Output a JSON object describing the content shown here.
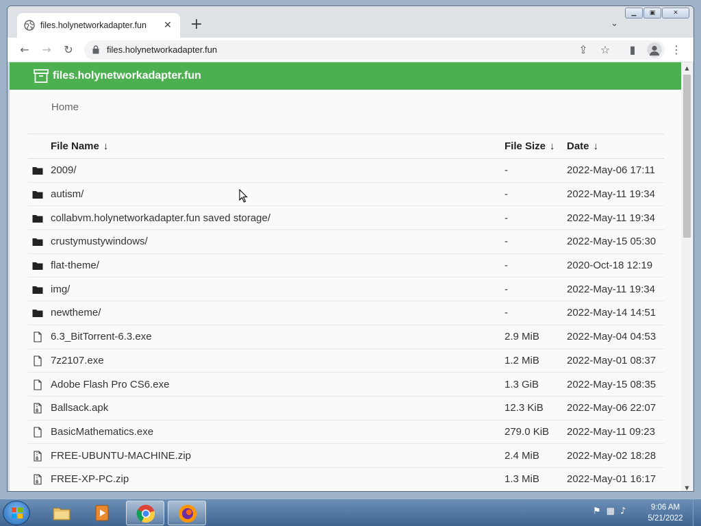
{
  "browser": {
    "tab_title": "files.holynetworkadapter.fun",
    "tab_close": "✕",
    "new_tab": "+",
    "tab_search": "⌄",
    "url": "files.holynetworkadapter.fun",
    "nav": {
      "back": "←",
      "forward": "→",
      "reload": "↻"
    },
    "toolbar_icons": {
      "share": "⇪",
      "bookmark": "☆",
      "side_panel": "▮",
      "menu": "⋮"
    }
  },
  "window_controls": {
    "minimize": "▁",
    "restore": "▣",
    "close": "✕"
  },
  "page": {
    "site_title": "files.holynetworkadapter.fun",
    "breadcrumb": "Home",
    "table_headers": {
      "name": "File Name",
      "size": "File Size",
      "date": "Date",
      "sort_arrow": "↓"
    },
    "rows": [
      {
        "icon": "folder-icon",
        "name": "2009/",
        "size": "-",
        "date": "2022-May-06 17:11"
      },
      {
        "icon": "folder-icon",
        "name": "autism/",
        "size": "-",
        "date": "2022-May-11 19:34"
      },
      {
        "icon": "folder-icon",
        "name": "collabvm.holynetworkadapter.fun saved storage/",
        "size": "-",
        "date": "2022-May-11 19:34"
      },
      {
        "icon": "folder-icon",
        "name": "crustymustywindows/",
        "size": "-",
        "date": "2022-May-15 05:30"
      },
      {
        "icon": "folder-icon",
        "name": "flat-theme/",
        "size": "-",
        "date": "2020-Oct-18 12:19"
      },
      {
        "icon": "folder-icon",
        "name": "img/",
        "size": "-",
        "date": "2022-May-11 19:34"
      },
      {
        "icon": "folder-icon",
        "name": "newtheme/",
        "size": "-",
        "date": "2022-May-14 14:51"
      },
      {
        "icon": "file-icon",
        "name": "6.3_BitTorrent-6.3.exe",
        "size": "2.9 MiB",
        "date": "2022-May-04 04:53"
      },
      {
        "icon": "file-icon",
        "name": "7z2107.exe",
        "size": "1.2 MiB",
        "date": "2022-May-01 08:37"
      },
      {
        "icon": "file-icon",
        "name": "Adobe Flash Pro CS6.exe",
        "size": "1.3 GiB",
        "date": "2022-May-15 08:35"
      },
      {
        "icon": "archive-file-icon",
        "name": "Ballsack.apk",
        "size": "12.3 KiB",
        "date": "2022-May-06 22:07"
      },
      {
        "icon": "file-icon",
        "name": "BasicMathematics.exe",
        "size": "279.0 KiB",
        "date": "2022-May-11 09:23"
      },
      {
        "icon": "archive-file-icon",
        "name": "FREE-UBUNTU-MACHINE.zip",
        "size": "2.4 MiB",
        "date": "2022-May-02 18:28"
      },
      {
        "icon": "archive-file-icon",
        "name": "FREE-XP-PC.zip",
        "size": "1.3 MiB",
        "date": "2022-May-01 16:17"
      }
    ]
  },
  "taskbar": {
    "clock_time": "9:06 AM",
    "clock_date": "5/21/2022",
    "apps": [
      "windows-explorer",
      "media-player",
      "google-chrome",
      "firefox"
    ]
  },
  "colors": {
    "header_green": "#4caf50",
    "page_bg": "#fafafa",
    "taskbar": "#4a73a0"
  }
}
